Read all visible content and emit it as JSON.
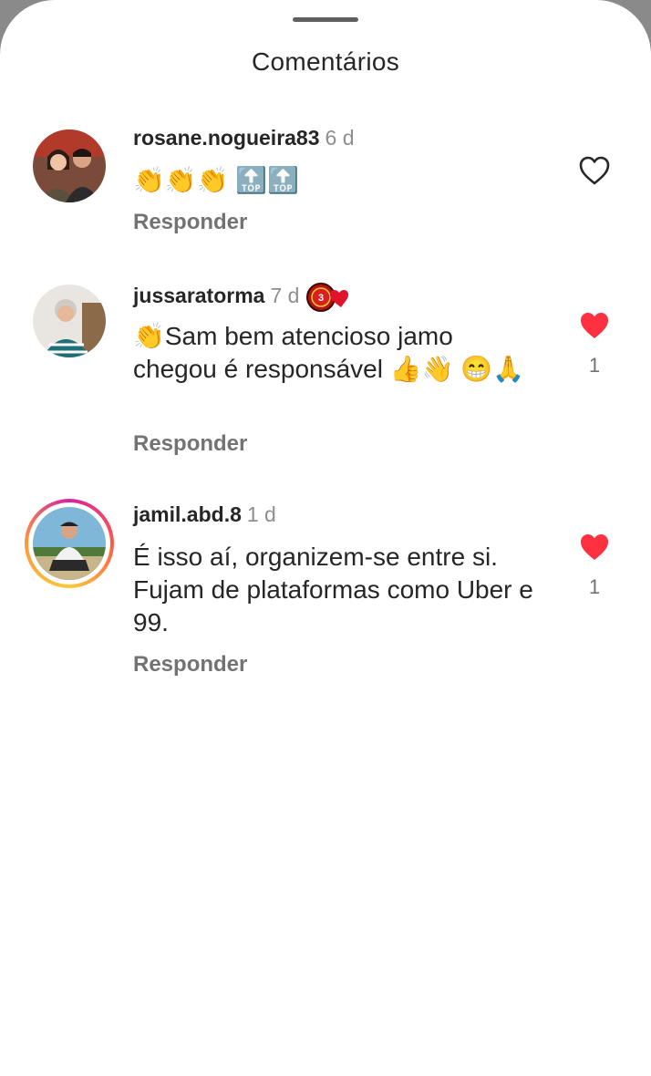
{
  "sheet": {
    "title": "Comentários"
  },
  "comments": [
    {
      "username": "rosane.nogueira83",
      "time": "6 d",
      "text": "👏👏👏 🔝🔝",
      "reply_label": "Responder",
      "liked": false,
      "like_count": ""
    },
    {
      "username": "jussaratorma",
      "time": "7 d",
      "text": "👏Sam bem atencioso jamo chegou é responsável 👍👋 😁🙏",
      "reply_label": "Responder",
      "liked": true,
      "like_count": "1"
    },
    {
      "username": "jamil.abd.8",
      "time": "1 d",
      "text": "É isso aí, organizem-se entre si. Fujam de plataformas como Uber e 99.",
      "reply_label": "Responder",
      "liked": true,
      "like_count": "1"
    }
  ],
  "colors": {
    "like_red": "#ff3040",
    "text": "#262626",
    "muted": "#737373",
    "time": "#8e8e8e"
  },
  "icons": {
    "like": "heart-icon",
    "handle": "drag-handle"
  }
}
